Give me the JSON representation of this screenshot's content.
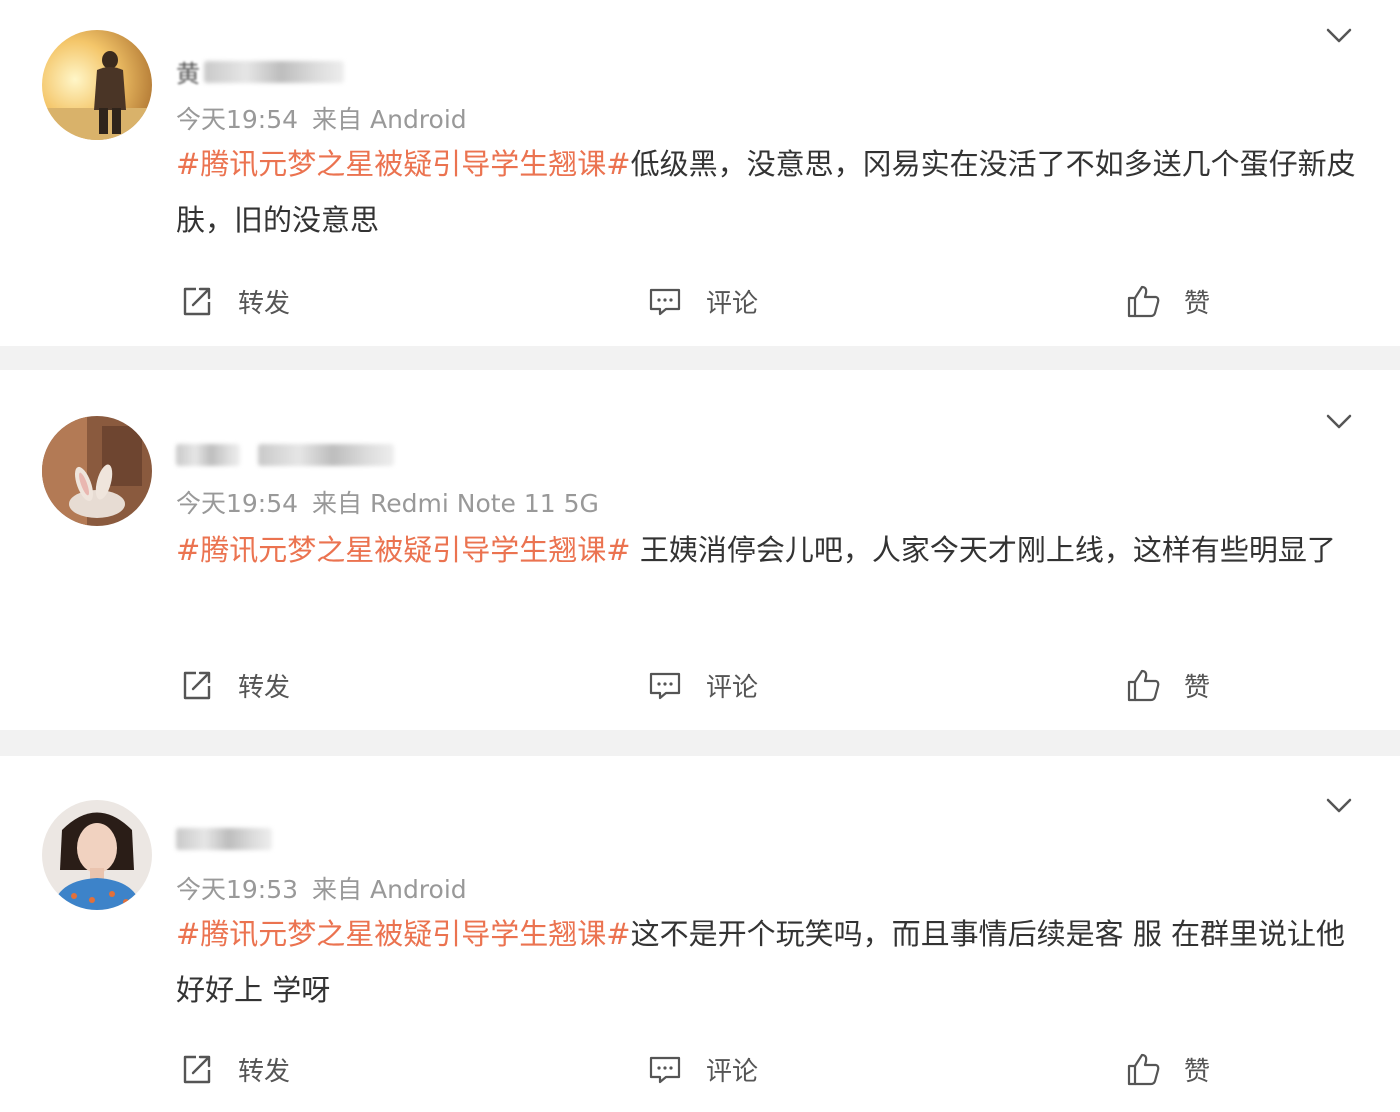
{
  "posts": [
    {
      "username_prefix": "黄",
      "time": "今天19:54",
      "source": "来自 Android",
      "topic": "#腾讯元梦之星被疑引导学生翘课#",
      "text": "低级黑，没意思，冈易实在没活了不如多送几个蛋仔新皮肤，旧的没意思",
      "actions": {
        "forward": "转发",
        "comment": "评论",
        "like": "赞"
      }
    },
    {
      "username_prefix": "",
      "time": "今天19:54",
      "source": "来自 Redmi Note 11 5G",
      "topic": "#腾讯元梦之星被疑引导学生翘课#",
      "text": " 王姨消停会儿吧，人家今天才刚上线，这样有些明显了",
      "actions": {
        "forward": "转发",
        "comment": "评论",
        "like": "赞"
      }
    },
    {
      "username_prefix": "",
      "time": "今天19:53",
      "source": "来自 Android",
      "topic": "#腾讯元梦之星被疑引导学生翘课#",
      "text": "这不是开个玩笑吗，而且事情后续是客 服 在群里说让他好好上 学呀",
      "actions": {
        "forward": "转发",
        "comment": "评论",
        "like": "赞"
      }
    }
  ],
  "icons": {
    "forward": "forward-icon",
    "comment": "comment-icon",
    "like": "thumbs-up-icon",
    "menu": "chevron-down-icon"
  },
  "colors": {
    "topic": "#eb7350",
    "meta": "#999999",
    "text": "#333333",
    "background": "#f2f2f2"
  }
}
